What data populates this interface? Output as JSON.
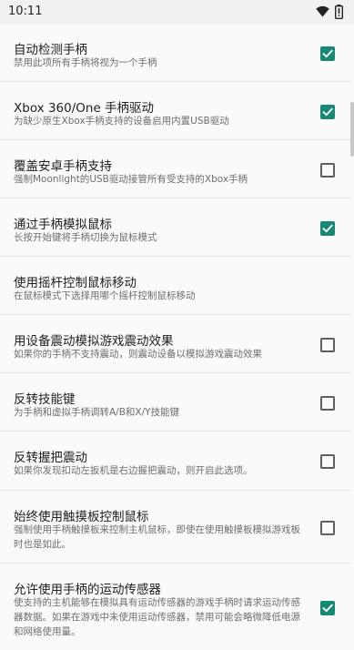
{
  "statusbar": {
    "time": "10:11"
  },
  "colors": {
    "accent": "#168974"
  },
  "settings": [
    {
      "title": "自动检测手柄",
      "summary": "禁用此项所有手柄将视为一个手柄",
      "checked": true
    },
    {
      "title": "Xbox 360/One 手柄驱动",
      "summary": "为缺少原生Xbox手柄支持的设备启用内置USB驱动",
      "checked": true
    },
    {
      "title": "覆盖安卓手柄支持",
      "summary": "强制Moonlight的USB驱动接管所有受支持的Xbox手柄",
      "checked": false
    },
    {
      "title": "通过手柄模拟鼠标",
      "summary": "长按开始键将手柄切换为鼠标模式",
      "checked": true
    },
    {
      "title": "使用摇杆控制鼠标移动",
      "summary": "在鼠标模式下选择用哪个摇杆控制鼠标移动",
      "checked": null
    },
    {
      "title": "用设备震动模拟游戏震动效果",
      "summary": "如果你的手柄不支持震动，则震动设备以模拟游戏震动效果",
      "checked": false
    },
    {
      "title": "反转技能键",
      "summary": "为手柄和虚拟手柄调转A/B和X/Y技能键",
      "checked": false
    },
    {
      "title": "反转握把震动",
      "summary": "如果你发现扣动左扳机是右边握把震动，则开启此选项。",
      "checked": false
    },
    {
      "title": "始终使用触摸板控制鼠标",
      "summary": "强制使用手柄触摸板来控制主机鼠标，即使在使用触摸板模拟游戏板时也是如此。",
      "checked": false
    },
    {
      "title": "允许使用手柄的运动传感器",
      "summary": "使支持的主机能够在模拟具有运动传感器的游戏手柄时请求运动传感器数据。如果在游戏中未使用运动传感器，禁用可能会略微降低电源和网络使用量。",
      "checked": true
    }
  ]
}
